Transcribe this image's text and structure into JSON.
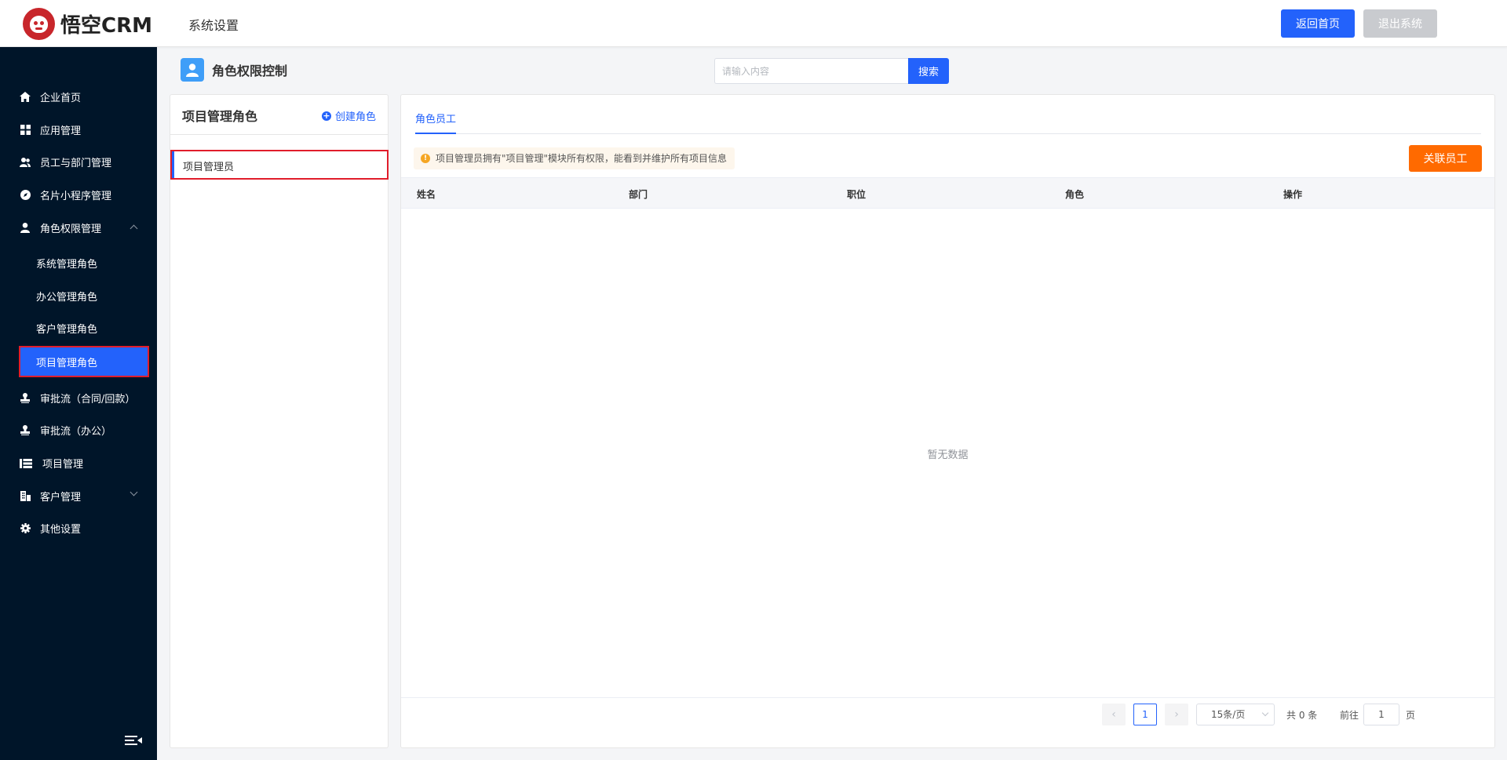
{
  "header": {
    "logo_text": "悟空CRM",
    "title": "系统设置",
    "home_button": "返回首页",
    "exit_button": "退出系统"
  },
  "sidebar": {
    "items": [
      {
        "label": "企业首页",
        "icon": "home-icon"
      },
      {
        "label": "应用管理",
        "icon": "grid-icon"
      },
      {
        "label": "员工与部门管理",
        "icon": "users-icon"
      },
      {
        "label": "名片小程序管理",
        "icon": "compass-icon"
      },
      {
        "label": "角色权限管理",
        "icon": "user-icon",
        "expanded": true
      },
      {
        "label": "审批流（合同/回款）",
        "icon": "stamp-icon"
      },
      {
        "label": "审批流（办公）",
        "icon": "stamp-icon"
      },
      {
        "label": "项目管理",
        "icon": "list-icon"
      },
      {
        "label": "客户管理",
        "icon": "building-icon",
        "expanded": false
      },
      {
        "label": "其他设置",
        "icon": "gear-icon"
      }
    ],
    "sub_items": [
      {
        "label": "系统管理角色"
      },
      {
        "label": "办公管理角色"
      },
      {
        "label": "客户管理角色"
      },
      {
        "label": "项目管理角色",
        "active": true
      }
    ]
  },
  "page": {
    "title": "角色权限控制",
    "search_placeholder": "请输入内容",
    "search_button": "搜索"
  },
  "left_panel": {
    "title": "项目管理角色",
    "create_label": "创建角色",
    "roles": [
      {
        "label": "项目管理员",
        "selected": true
      }
    ]
  },
  "right_panel": {
    "tab": "角色员工",
    "notice": "项目管理员拥有\"项目管理\"模块所有权限，能看到并维护所有项目信息",
    "link_button": "关联员工",
    "columns": [
      "姓名",
      "部门",
      "职位",
      "角色",
      "操作"
    ],
    "empty_text": "暂无数据",
    "pagination": {
      "current_page": "1",
      "page_size": "15条/页",
      "total": "共 0 条",
      "goto_label": "前往",
      "goto_value": "1",
      "page_suffix": "页"
    }
  },
  "colors": {
    "primary": "#2362fb",
    "sidebar_bg": "#001529",
    "orange": "#ff6a00",
    "highlight_border": "#e11d2b"
  }
}
